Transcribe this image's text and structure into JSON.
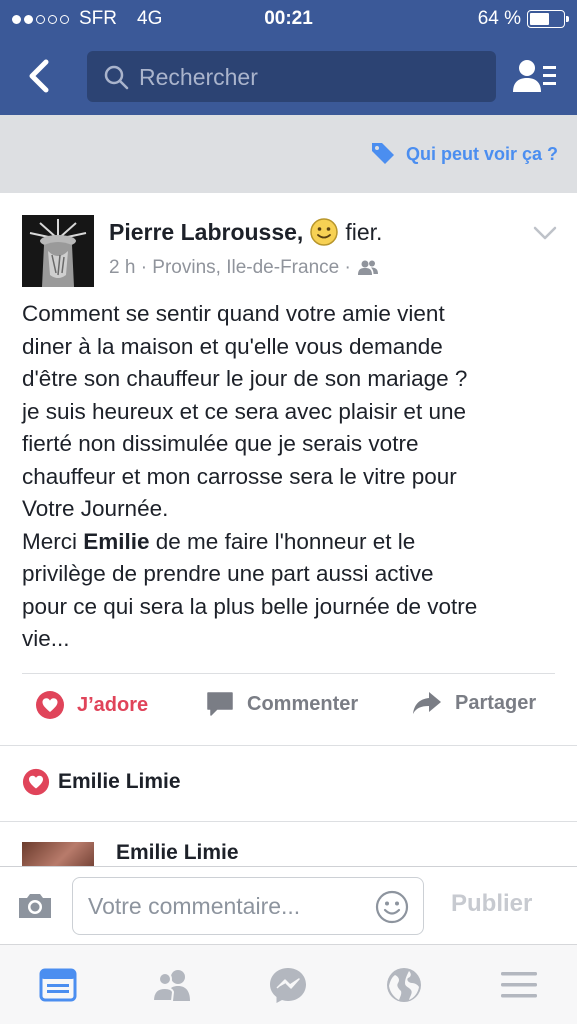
{
  "status_bar": {
    "carrier": "SFR",
    "network": "4G",
    "time": "00:21",
    "battery": "64 %",
    "battery_level": 0.64
  },
  "nav": {
    "search_placeholder": "Rechercher"
  },
  "privacy": {
    "label": "Qui peut voir ça ?"
  },
  "post": {
    "author": "Pierre Labrousse,",
    "feeling": "fier.",
    "meta": "2 h · Provins, Ile-de-France ·",
    "text_lines": [
      "Comment se sentir quand votre amie vient",
      "diner à la maison et qu'elle vous demande",
      "d'être son chauffeur le jour de son mariage ?",
      "je suis heureux et ce sera avec plaisir et une",
      "fierté non dissimulée que je serais votre",
      "chauffeur et mon carrosse sera le vitre pour",
      "Votre Journée."
    ],
    "thanks_prefix": "Merci ",
    "thanks_name": "Emilie",
    "thanks_suffix": " de me faire l'honneur et le",
    "tail_lines": [
      "privilège de prendre une part aussi active",
      "pour ce qui sera la plus belle journée de votre",
      "vie..."
    ]
  },
  "actions": {
    "love": "J’adore",
    "comment": "Commenter",
    "share": "Partager"
  },
  "reactions": {
    "name": "Emilie Limie"
  },
  "comment_preview": {
    "name": "Emilie Limie"
  },
  "composer": {
    "placeholder": "Votre commentaire...",
    "publish": "Publier"
  },
  "colors": {
    "brand": "#3b5998",
    "love": "#e0445a",
    "link": "#4b8ef0"
  }
}
